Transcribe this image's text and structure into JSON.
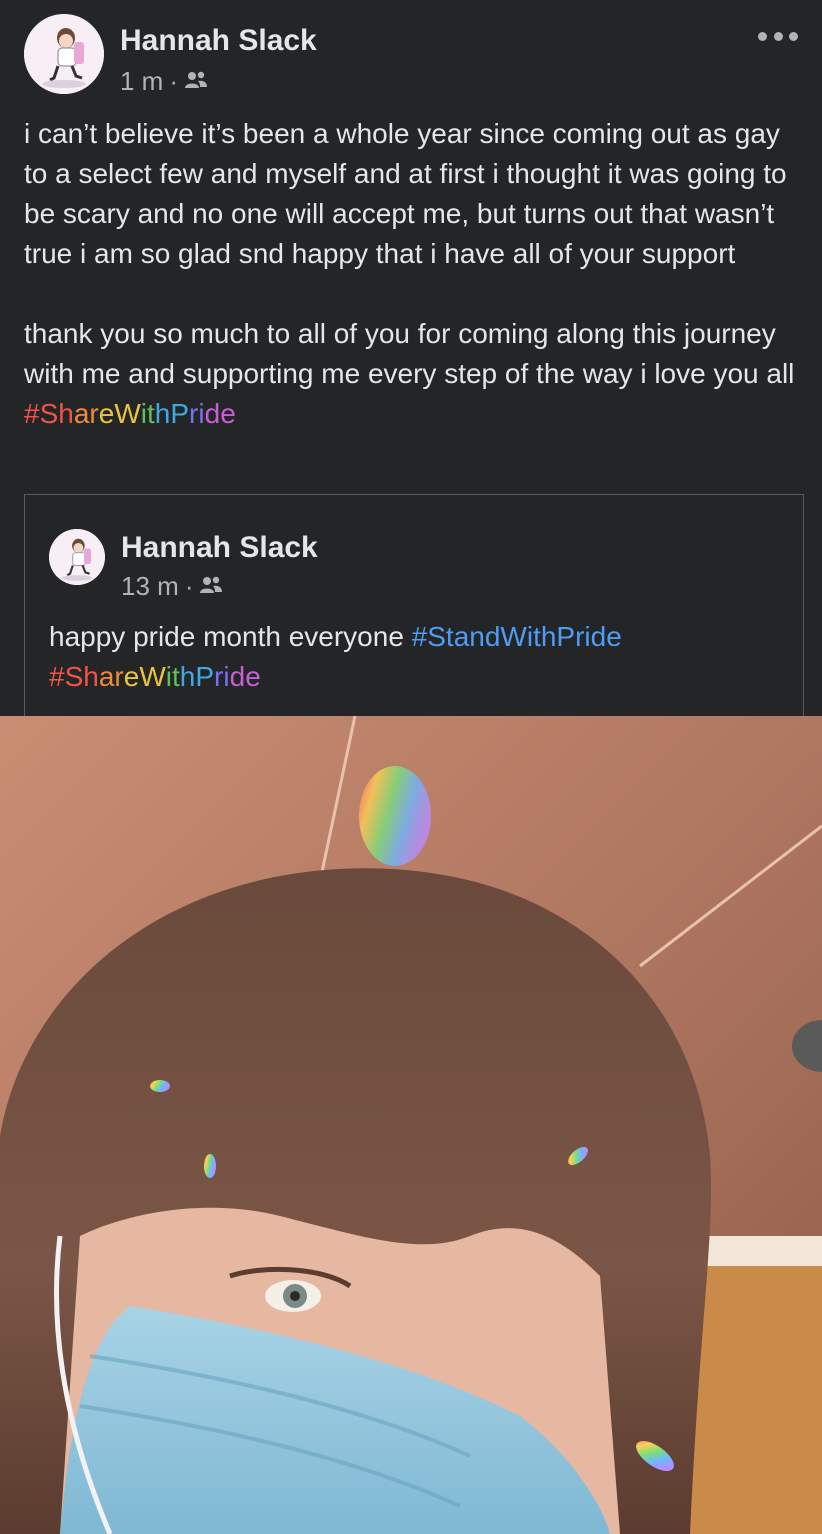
{
  "post": {
    "author": "Hannah Slack",
    "time": "1 m",
    "separator": "·",
    "audience_icon": "friends-icon",
    "more_icon": "more-options-icon",
    "paragraph1": "i can’t believe it’s been a whole year since coming out as gay to a select few and myself and at first i thought it was going to be scary and no one will accept me, but turns out that wasn’t true i am so glad snd happy that i have all of your support",
    "paragraph2_text": "thank you so much to all of you for coming along this journey with me and supporting me every step of the way i love you all ",
    "paragraph2_hashtag": "#ShareWithPride"
  },
  "shared_post": {
    "author": "Hannah Slack",
    "time": "13 m",
    "separator": "·",
    "audience_icon": "friends-icon",
    "text": "happy pride month everyone ",
    "hashtag1": "#StandWithPride",
    "hashtag2": "#ShareWithPride"
  },
  "colors": {
    "background": "#242526",
    "text": "#e4e6eb",
    "secondary_text": "#b0b3b8",
    "hashtag_blue": "#4e9cf5",
    "rainbow": [
      "#f0534a",
      "#f08a3c",
      "#e9c440",
      "#5cc05c",
      "#3fa9e6",
      "#7a6ff0",
      "#c65fd6"
    ]
  }
}
